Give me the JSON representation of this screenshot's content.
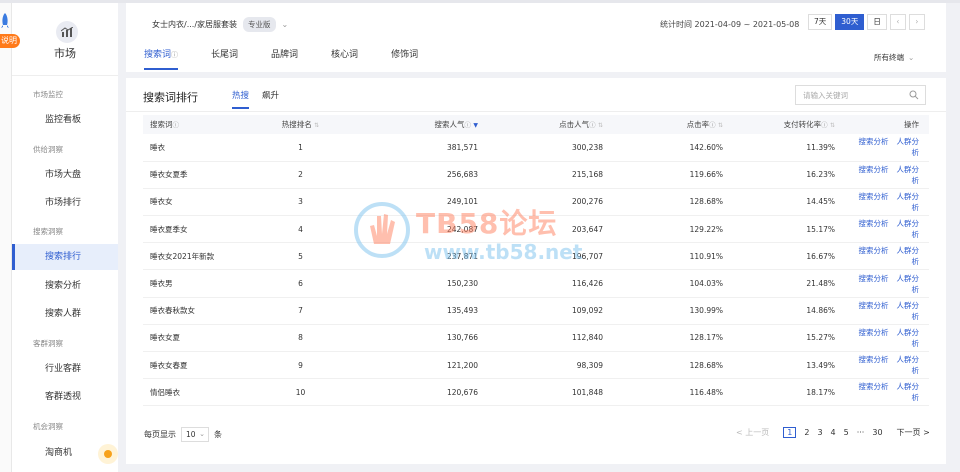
{
  "rail": {
    "badge": "说明"
  },
  "sidebar": {
    "title": "市场",
    "groups": [
      {
        "label": "市场监控",
        "items": [
          "监控看板"
        ]
      },
      {
        "label": "供给洞察",
        "items": [
          "市场大盘",
          "市场排行"
        ]
      },
      {
        "label": "搜索洞察",
        "items": [
          "搜索排行",
          "搜索分析",
          "搜索人群"
        ]
      },
      {
        "label": "客群洞察",
        "items": [
          "行业客群",
          "客群透视"
        ]
      },
      {
        "label": "机会洞察",
        "items": [
          "淘商机"
        ]
      }
    ],
    "active_item": "搜索排行"
  },
  "header": {
    "breadcrumb": "女士内衣/.../家居服套装",
    "edition": "专业版",
    "stat_date": "统计时间 2021-04-09 ~ 2021-05-08",
    "range_buttons": [
      "7天",
      "30天",
      "日"
    ],
    "active_range": "30天",
    "tabs": [
      "搜索词",
      "长尾词",
      "品牌词",
      "核心词",
      "修饰词"
    ],
    "active_tab": "搜索词",
    "terminal": "所有终端"
  },
  "main": {
    "title": "搜索词排行",
    "sub_tabs": [
      "热搜",
      "飙升"
    ],
    "active_sub_tab": "热搜",
    "search_placeholder": "请输入关键词",
    "columns": [
      "搜索词",
      "热搜排名",
      "搜索人气",
      "点击人气",
      "点击率",
      "支付转化率",
      "操作"
    ],
    "op_links": [
      "搜索分析",
      "人群分析"
    ],
    "rows": [
      [
        "睡衣",
        "1",
        "381,571",
        "300,238",
        "142.60%",
        "11.39%"
      ],
      [
        "睡衣女夏季",
        "2",
        "256,683",
        "215,168",
        "119.66%",
        "16.23%"
      ],
      [
        "睡衣女",
        "3",
        "249,101",
        "200,276",
        "128.68%",
        "14.45%"
      ],
      [
        "睡衣夏季女",
        "4",
        "242,087",
        "203,647",
        "129.22%",
        "15.17%"
      ],
      [
        "睡衣女2021年新款",
        "5",
        "237,871",
        "196,707",
        "110.91%",
        "16.67%"
      ],
      [
        "睡衣男",
        "6",
        "150,230",
        "116,426",
        "104.03%",
        "21.48%"
      ],
      [
        "睡衣春秋款女",
        "7",
        "135,493",
        "109,092",
        "130.99%",
        "14.86%"
      ],
      [
        "睡衣女夏",
        "8",
        "130,766",
        "112,840",
        "128.17%",
        "15.27%"
      ],
      [
        "睡衣女春夏",
        "9",
        "121,200",
        "98,309",
        "128.68%",
        "13.49%"
      ],
      [
        "情侣睡衣",
        "10",
        "120,676",
        "101,848",
        "116.48%",
        "18.17%"
      ]
    ],
    "page_size_prefix": "每页显示",
    "page_size": "10",
    "page_size_suffix": "条",
    "pager": {
      "prev": "< 上一页",
      "pages": [
        "1",
        "2",
        "3",
        "4",
        "5"
      ],
      "ellipsis": "···",
      "last": "30",
      "next": "下一页 >",
      "current": "1"
    }
  },
  "watermark": {
    "line1": "TB58论坛",
    "line2": "www.tb58.net"
  }
}
